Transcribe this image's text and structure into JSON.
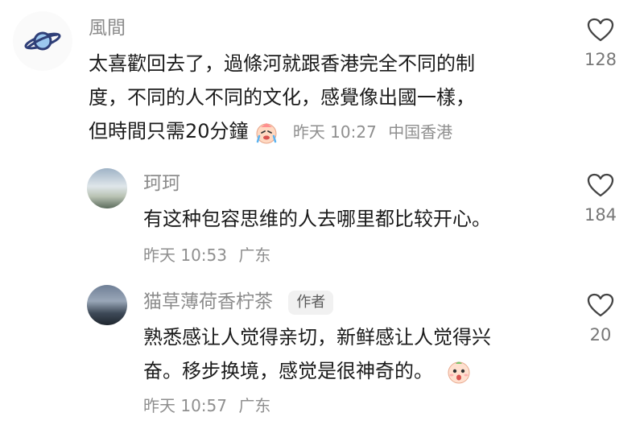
{
  "comments": [
    {
      "username": "風間",
      "lines": [
        "太喜歡回去了，過條河就跟香港完全不同的制",
        "度，不同的人不同的文化，感覺像出國一樣，",
        "但時間只需20分鐘"
      ],
      "emoji": "crying-laugh-emoji",
      "time": "昨天 10:27",
      "location": "中国香港",
      "likes": "128"
    },
    {
      "username": "珂珂",
      "lines": [
        "有这种包容思维的人去哪里都比较开心。"
      ],
      "time": "昨天 10:53",
      "location": "广东",
      "likes": "184"
    },
    {
      "username": "猫草薄荷香柠茶",
      "author_tag": "作者",
      "lines": [
        "熟悉感让人觉得亲切，新鲜感让人觉得兴",
        "奋。移步换境，感觉是很神奇的。"
      ],
      "emoji": "surprised-emoji",
      "time": "昨天 10:57",
      "location": "广东",
      "likes": "20"
    }
  ],
  "icons": {
    "avatar_main": "planet-icon",
    "like": "heart-outline-icon"
  },
  "colors": {
    "username": "#8c8c8c",
    "text": "#1b1b1b",
    "meta": "#8f8f8f"
  }
}
